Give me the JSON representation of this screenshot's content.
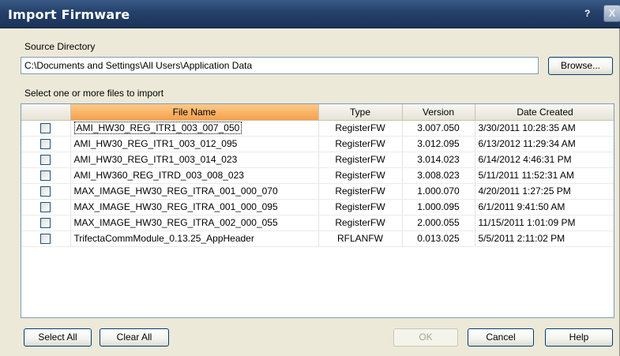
{
  "window": {
    "title": "Import Firmware",
    "help_glyph": "?",
    "close_glyph": "X"
  },
  "source": {
    "label": "Source Directory",
    "path": "C:\\Documents and Settings\\All Users\\Application Data",
    "browse_label": "Browse..."
  },
  "select_label": "Select one or more files to import",
  "table": {
    "columns": [
      "",
      "File Name",
      "Type",
      "Version",
      "Date Created"
    ],
    "rows": [
      {
        "name": "AMI_HW30_REG_ITR1_003_007_050",
        "type": "RegisterFW",
        "version": "3.007.050",
        "date": "3/30/2011 10:28:35 AM"
      },
      {
        "name": "AMI_HW30_REG_ITR1_003_012_095",
        "type": "RegisterFW",
        "version": "3.012.095",
        "date": "6/13/2012 11:29:34 AM"
      },
      {
        "name": "AMI_HW30_REG_ITR1_003_014_023",
        "type": "RegisterFW",
        "version": "3.014.023",
        "date": "6/14/2012 4:46:31 PM"
      },
      {
        "name": "AMI_HW360_REG_ITRD_003_008_023",
        "type": "RegisterFW",
        "version": "3.008.023",
        "date": "5/11/2011 11:52:31 AM"
      },
      {
        "name": "MAX_IMAGE_HW30_REG_ITRA_001_000_070",
        "type": "RegisterFW",
        "version": "1.000.070",
        "date": "4/20/2011 1:27:25 PM"
      },
      {
        "name": "MAX_IMAGE_HW30_REG_ITRA_001_000_095",
        "type": "RegisterFW",
        "version": "1.000.095",
        "date": "6/1/2011 9:41:50 AM"
      },
      {
        "name": "MAX_IMAGE_HW30_REG_ITRA_002_000_055",
        "type": "RegisterFW",
        "version": "2.000.055",
        "date": "11/15/2011 1:01:09 PM"
      },
      {
        "name": "TrifectaCommModule_0.13.25_AppHeader",
        "type": "RFLANFW",
        "version": "0.013.025",
        "date": "5/5/2011 2:11:02 PM"
      }
    ]
  },
  "buttons": {
    "select_all": "Select All",
    "clear_all": "Clear All",
    "ok": "OK",
    "cancel": "Cancel",
    "help": "Help"
  }
}
